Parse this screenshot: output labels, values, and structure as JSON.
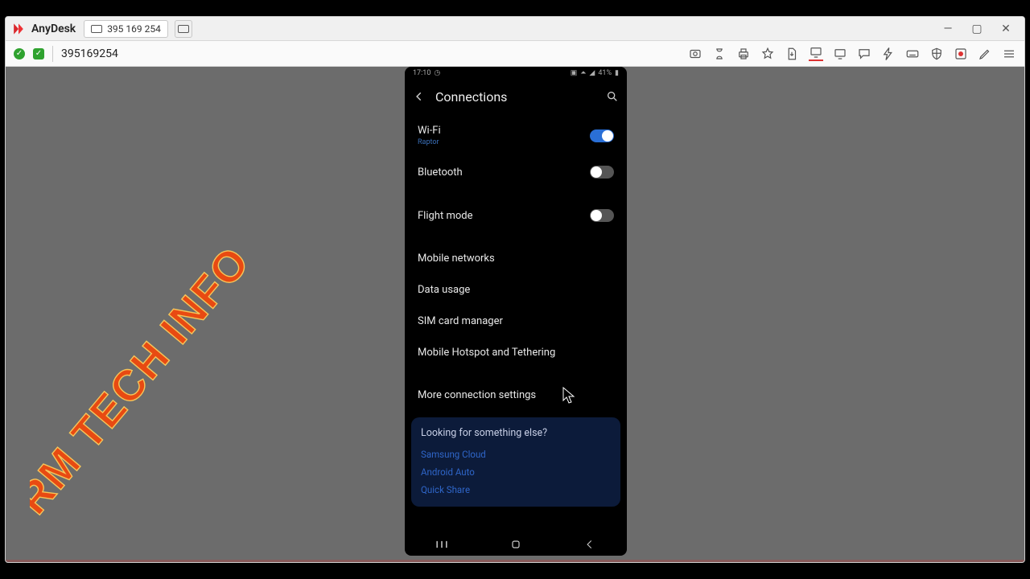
{
  "app": {
    "name": "AnyDesk",
    "address": "395 169 254"
  },
  "session": {
    "id": "395169254"
  },
  "win": {
    "min": "—",
    "max": "▢",
    "close": "✕"
  },
  "watermark": "RM TECH INFO",
  "phone": {
    "statusbar": {
      "time": "17:10",
      "battery": "41%"
    },
    "title": "Connections",
    "wifi": {
      "label": "Wi-Fi",
      "sub": "Raptor",
      "on": true
    },
    "bluetooth": {
      "label": "Bluetooth",
      "on": false
    },
    "flight": {
      "label": "Flight mode",
      "on": false
    },
    "rows": {
      "mobile_networks": "Mobile networks",
      "data_usage": "Data usage",
      "sim": "SIM card manager",
      "hotspot": "Mobile Hotspot and Tethering",
      "more": "More connection settings"
    },
    "card": {
      "q": "Looking for something else?",
      "links": {
        "a": "Samsung Cloud",
        "b": "Android Auto",
        "c": "Quick Share"
      }
    }
  }
}
